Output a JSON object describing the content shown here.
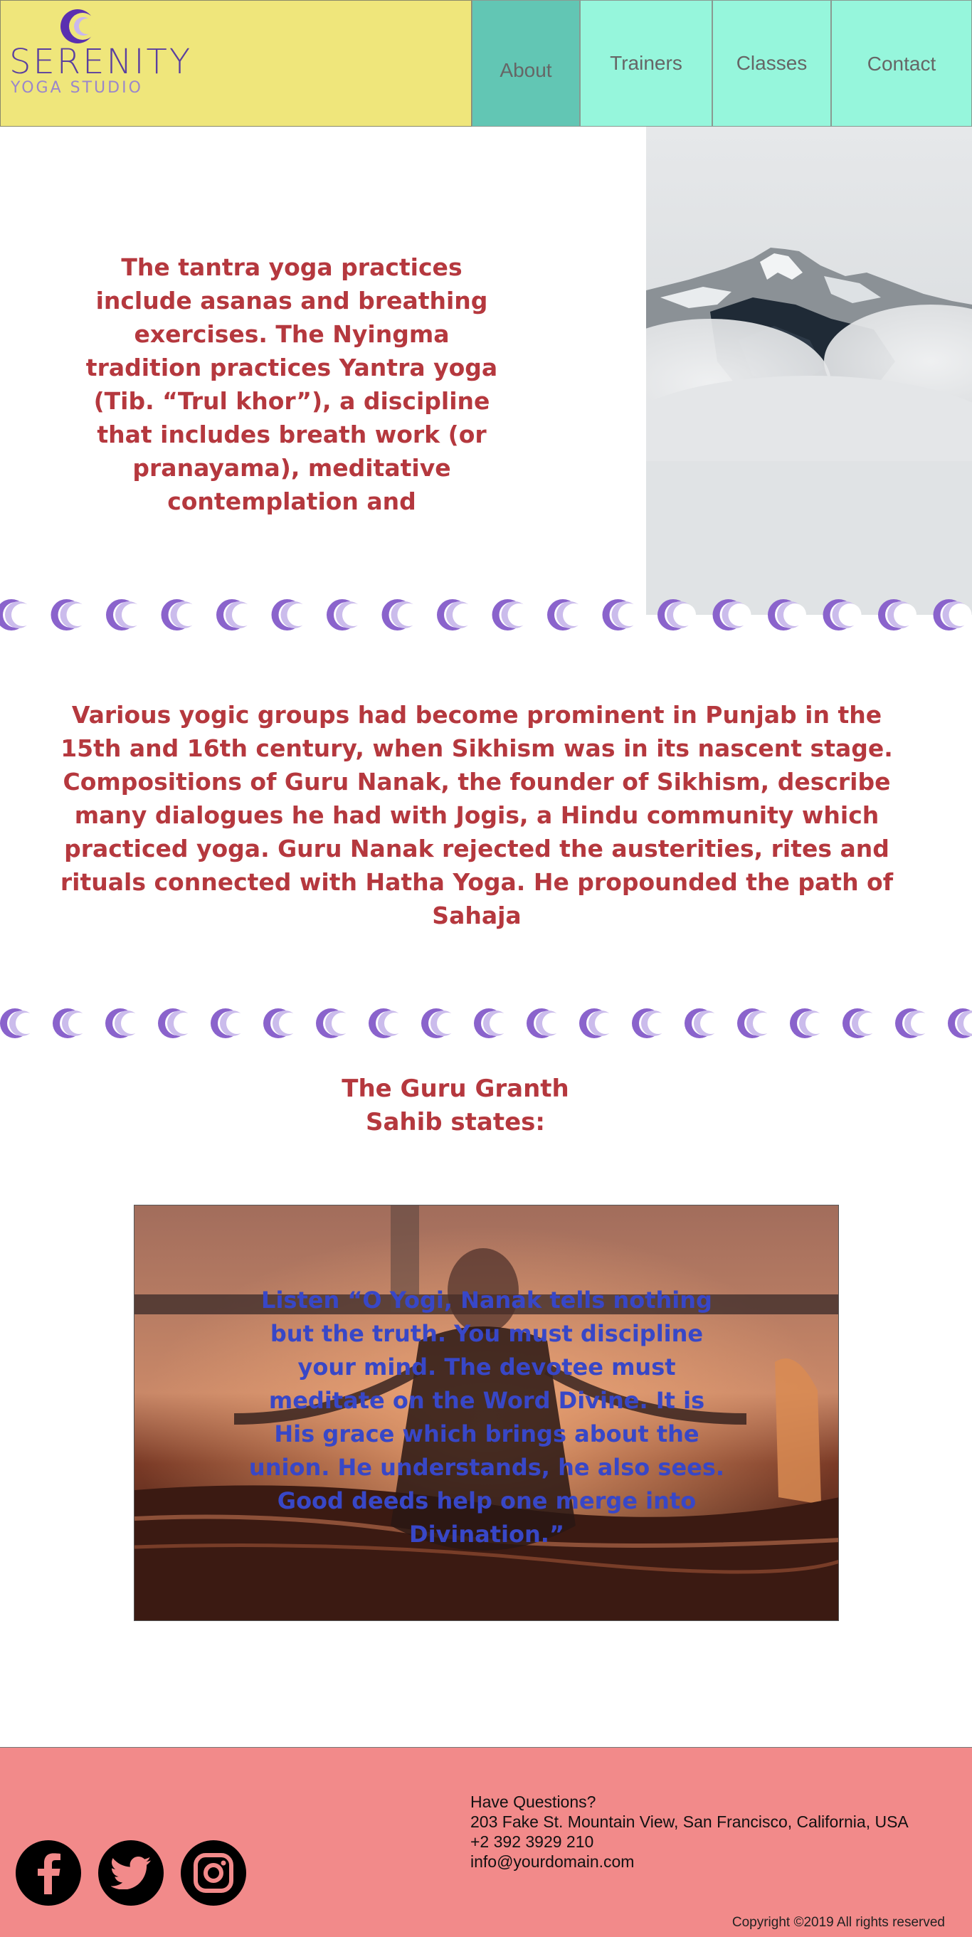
{
  "brand": {
    "name": "SERENITY",
    "tagline": "YOGA STUDIO",
    "colors": {
      "logo_bg": "#efe67b",
      "logo_text": "#5a3fa0",
      "nav_bg": "#96f6dc",
      "nav_active": "#62c6b4"
    }
  },
  "nav": {
    "items": [
      {
        "label": "About",
        "active": true
      },
      {
        "label": "Trainers",
        "active": false
      },
      {
        "label": "Classes",
        "active": false
      },
      {
        "label": "Contact",
        "active": false
      }
    ]
  },
  "section1": {
    "text": "The tantra yoga practices include asanas and breathing exercises. The Nyingma tradition practices Yantra yoga (Tib. “Trul khor”), a discipline that includes breath work (or pranayama), meditative contemplation and",
    "image_icon": "mountain-clouds-image"
  },
  "section2": {
    "text": "Various yogic groups had become prominent in Punjab in the 15th and 16th century, when Sikhism was in its nascent stage. Compositions of Guru Nanak, the founder of Sikhism, describe many dialogues he had with Jogis, a Hindu community which practiced yoga. Guru Nanak rejected the austerities, rites and rituals connected with Hatha Yoga. He propounded the path of Sahaja"
  },
  "section3": {
    "heading": "The Guru Granth Sahib states:",
    "quote": "Listen “O Yogi, Nanak tells nothing but the truth. You must discipline your mind. The devotee must meditate on the Word Divine. It is His grace which brings about the union. He understands, he also sees. Good deeds help one merge into Divination.”"
  },
  "footer": {
    "social": [
      "facebook-icon",
      "twitter-icon",
      "instagram-icon"
    ],
    "contact": {
      "heading": "Have Questions?",
      "address": "203 Fake St. Mountain View, San Francisco, California, USA",
      "phone": "+2 392 3929 210",
      "email": "info@yourdomain.com"
    },
    "copyright": "Copyright ©2019 All rights reserved",
    "bg_color": "#f28a8a"
  }
}
